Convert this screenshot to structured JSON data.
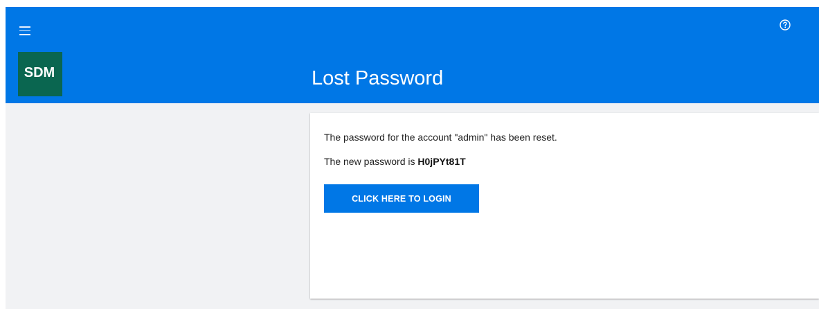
{
  "header": {
    "menu_icon": "hamburger-menu-icon",
    "help_icon": "help-circle-icon",
    "logo_text": "SDM",
    "title": "Lost Password"
  },
  "colors": {
    "header_bg": "#0077e6",
    "logo_bg": "#0a6650",
    "body_bg": "#f1f2f4",
    "button_bg": "#0077e6"
  },
  "main": {
    "message_reset": "The password for the account \"admin\" has been reset.",
    "new_password_prefix": "The new password is ",
    "new_password": "H0jPYt81T",
    "login_button_label": "CLICK HERE TO LOGIN"
  }
}
